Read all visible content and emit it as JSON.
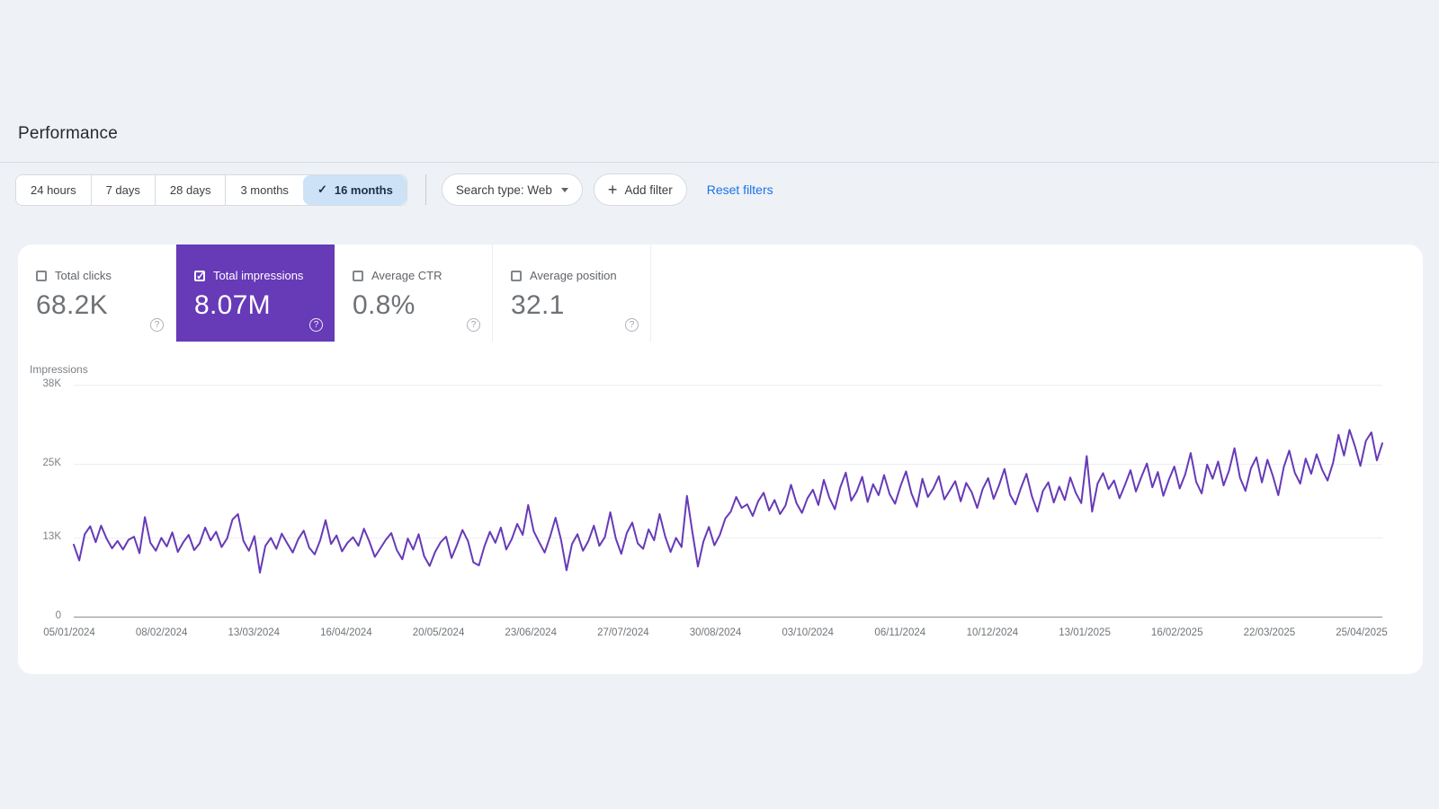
{
  "header": {
    "title": "Performance"
  },
  "toolbar": {
    "ranges": [
      {
        "label": "24 hours",
        "selected": false
      },
      {
        "label": "7 days",
        "selected": false
      },
      {
        "label": "28 days",
        "selected": false
      },
      {
        "label": "3 months",
        "selected": false
      },
      {
        "label": "16 months",
        "selected": true
      }
    ],
    "search_type_label": "Search type: Web",
    "add_filter_label": "Add filter",
    "reset_label": "Reset filters"
  },
  "cards": [
    {
      "label": "Total clicks",
      "value": "68.2K",
      "checked": false,
      "selected": false
    },
    {
      "label": "Total impressions",
      "value": "8.07M",
      "checked": true,
      "selected": true
    },
    {
      "label": "Average CTR",
      "value": "0.8%",
      "checked": false,
      "selected": false
    },
    {
      "label": "Average position",
      "value": "32.1",
      "checked": false,
      "selected": false
    }
  ],
  "colors": {
    "accent_purple": "#673ab7",
    "selected_chip_bg": "#cde2f7",
    "link_blue": "#1a73e8",
    "panel_bg": "#ffffff",
    "page_bg": "#eef1f6"
  },
  "chart_data": {
    "type": "line",
    "title": "Impressions over 16 months",
    "ylabel": "Impressions",
    "series_name": "Impressions",
    "line_color": "#673ab7",
    "grid": "horizontal",
    "ylim": [
      0,
      38000
    ],
    "y_ticks": [
      {
        "label": "38K",
        "value": 38000
      },
      {
        "label": "25K",
        "value": 25000
      },
      {
        "label": "13K",
        "value": 13000
      },
      {
        "label": "0",
        "value": 0
      }
    ],
    "x_labels": [
      "05/01/2024",
      "08/02/2024",
      "13/03/2024",
      "16/04/2024",
      "20/05/2024",
      "23/06/2024",
      "27/07/2024",
      "30/08/2024",
      "03/10/2024",
      "06/11/2024",
      "10/12/2024",
      "13/01/2025",
      "16/02/2025",
      "22/03/2025",
      "25/04/2025"
    ],
    "values_unit": "thousands",
    "values": [
      11.8,
      9.2,
      13.5,
      14.8,
      12.2,
      14.9,
      12.8,
      11.2,
      12.4,
      11.0,
      12.6,
      13.1,
      10.4,
      16.3,
      12.1,
      10.8,
      12.9,
      11.5,
      13.8,
      10.6,
      12.2,
      13.4,
      10.9,
      12.0,
      14.6,
      12.5,
      13.9,
      11.4,
      12.8,
      15.9,
      16.8,
      12.4,
      10.8,
      13.2,
      7.2,
      11.6,
      12.9,
      11.1,
      13.6,
      12.0,
      10.5,
      12.7,
      14.1,
      11.3,
      10.2,
      12.5,
      15.8,
      11.9,
      13.3,
      10.7,
      12.1,
      13.0,
      11.6,
      14.4,
      12.3,
      9.8,
      11.2,
      12.6,
      13.7,
      10.9,
      9.4,
      12.8,
      11.0,
      13.5,
      9.9,
      8.3,
      10.6,
      12.2,
      13.1,
      9.6,
      11.8,
      14.2,
      12.4,
      8.9,
      8.4,
      11.5,
      13.9,
      12.1,
      14.6,
      11.0,
      12.7,
      15.2,
      13.4,
      18.3,
      14.0,
      12.2,
      10.5,
      13.1,
      16.2,
      12.6,
      7.6,
      11.9,
      13.5,
      10.8,
      12.4,
      14.9,
      11.6,
      13.0,
      17.1,
      12.8,
      10.3,
      13.7,
      15.4,
      12.0,
      11.1,
      14.3,
      12.5,
      16.8,
      13.2,
      10.6,
      12.9,
      11.4,
      19.8,
      13.8,
      8.2,
      12.3,
      14.7,
      11.7,
      13.4,
      16.1,
      17.2,
      19.6,
      17.8,
      18.4,
      16.5,
      18.9,
      20.3,
      17.4,
      19.1,
      16.8,
      18.2,
      21.6,
      18.6,
      17.0,
      19.4,
      20.8,
      18.3,
      22.4,
      19.5,
      17.6,
      21.2,
      23.6,
      19.0,
      20.5,
      22.9,
      18.8,
      21.7,
      19.9,
      23.2,
      20.1,
      18.5,
      21.4,
      23.8,
      20.2,
      18.0,
      22.6,
      19.6,
      21.0,
      23.0,
      19.2,
      20.7,
      22.2,
      18.9,
      21.9,
      20.4,
      17.8,
      20.9,
      22.7,
      19.3,
      21.5,
      24.2,
      20.0,
      18.4,
      21.1,
      23.4,
      19.7,
      17.2,
      20.6,
      22.0,
      18.7,
      21.3,
      19.1,
      22.8,
      20.3,
      18.6,
      26.3,
      17.2,
      21.8,
      23.5,
      20.9,
      22.3,
      19.4,
      21.6,
      24.0,
      20.5,
      22.9,
      25.1,
      21.2,
      23.7,
      19.8,
      22.4,
      24.6,
      21.0,
      23.3,
      26.8,
      22.1,
      20.2,
      24.9,
      22.6,
      25.4,
      21.5,
      23.9,
      27.6,
      22.8,
      20.6,
      24.3,
      26.1,
      22.0,
      25.7,
      23.1,
      19.9,
      24.5,
      27.2,
      23.6,
      21.8,
      25.9,
      23.4,
      26.6,
      24.1,
      22.3,
      25.2,
      29.8,
      26.4,
      30.6,
      27.9,
      24.7,
      28.8,
      30.2,
      25.6,
      28.4
    ]
  }
}
